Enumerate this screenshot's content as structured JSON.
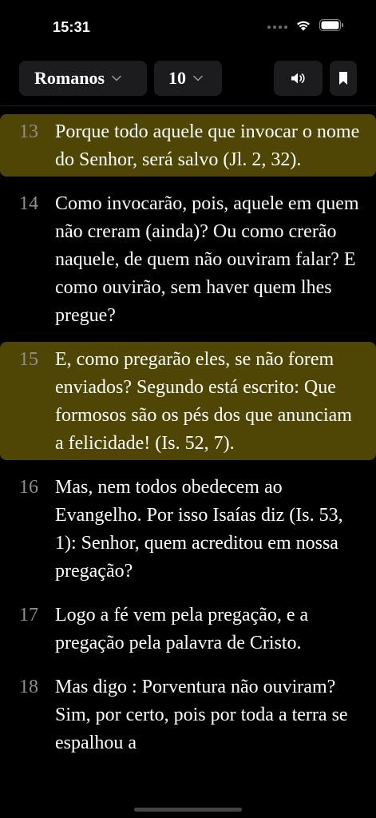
{
  "status": {
    "time": "15:31"
  },
  "toolbar": {
    "book": "Romanos",
    "chapter": "10",
    "audio_icon": "speaker-icon",
    "bookmark_icon": "bookmark-icon"
  },
  "verses": [
    {
      "number": "13",
      "text": "Porque todo aquele que invocar o nome do Senhor, será salvo (Jl. 2, 32).",
      "highlighted": true
    },
    {
      "number": "14",
      "text": "Como invocarão, pois, aquele em quem não creram (ainda)? Ou como crerão naquele, de quem não ouviram falar? E como ouvirão, sem haver quem lhes pregue?",
      "highlighted": false
    },
    {
      "number": "15",
      "text": "E, como pregarão eles, se não forem enviados? Segundo está escrito: Que formosos são os pés dos que anunciam a felicidade! (Is. 52, 7).",
      "highlighted": true
    },
    {
      "number": "16",
      "text": "Mas, nem todos obedecem ao Evangelho. Por isso Isaías diz (Is. 53, 1): Senhor, quem acreditou em nossa pregação?",
      "highlighted": false
    },
    {
      "number": "17",
      "text": "Logo a fé vem pela pregação, e a pregação pela palavra de Cristo.",
      "highlighted": false
    },
    {
      "number": "18",
      "text": "Mas digo : Porventura não ouviram? Sim, por certo, pois por toda a terra se espalhou a",
      "highlighted": false
    }
  ],
  "colors": {
    "highlight": "#4f4606",
    "pill_bg": "#1c1c1e",
    "verse_number": "#8e8e93"
  }
}
